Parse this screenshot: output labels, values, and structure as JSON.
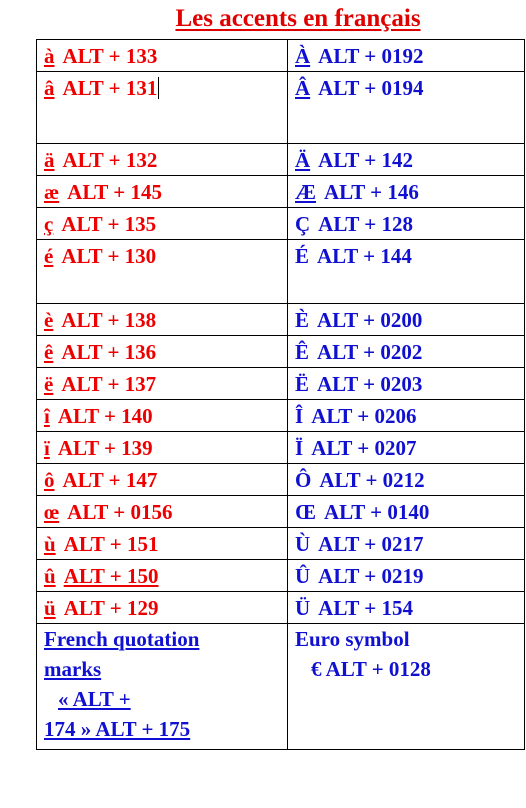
{
  "title": "Les accents en français",
  "colors": {
    "title_red": "#e00000",
    "lowercase_red": "#ee0000",
    "uppercase_blue": "#1010d0",
    "border_black": "#000000",
    "background": "#ffffff"
  },
  "table": {
    "rows": [
      {
        "left": {
          "letter": "à",
          "code": "ALT + 133",
          "letter_underlined": true,
          "code_underlined": false,
          "caret": false
        },
        "right": {
          "letter": "À",
          "code": "ALT + 0192",
          "letter_underlined": true,
          "code_underlined": false
        }
      },
      {
        "left": {
          "letter": "â",
          "code": "ALT + 131",
          "letter_underlined": true,
          "code_underlined": false,
          "caret": true
        },
        "right": {
          "letter": "Â",
          "code": "ALT + 0194",
          "letter_underlined": true,
          "code_underlined": false
        }
      },
      {
        "left": {
          "letter": "ä",
          "code": "ALT + 132",
          "letter_underlined": true,
          "code_underlined": false,
          "caret": false
        },
        "right": {
          "letter": "Ä",
          "code": "ALT + 142",
          "letter_underlined": true,
          "code_underlined": false
        }
      },
      {
        "left": {
          "letter": "æ",
          "code": "ALT + 145",
          "letter_underlined": true,
          "code_underlined": false,
          "caret": false
        },
        "right": {
          "letter": "Æ",
          "code": "ALT + 146",
          "letter_underlined": true,
          "code_underlined": false
        }
      },
      {
        "left": {
          "letter": "ç",
          "code": "ALT + 135",
          "letter_underlined": true,
          "code_underlined": false,
          "caret": false
        },
        "right": {
          "letter": "Ç",
          "code": "ALT + 128",
          "letter_underlined": false,
          "code_underlined": false
        }
      },
      {
        "left": {
          "letter": "é",
          "code": "ALT + 130",
          "letter_underlined": true,
          "code_underlined": false,
          "caret": false
        },
        "right": {
          "letter": "É",
          "code": "ALT + 144",
          "letter_underlined": false,
          "code_underlined": false
        }
      },
      {
        "left": {
          "letter": "è",
          "code": "ALT + 138",
          "letter_underlined": true,
          "code_underlined": false,
          "caret": false
        },
        "right": {
          "letter": "È",
          "code": "ALT + 0200",
          "letter_underlined": false,
          "code_underlined": false
        }
      },
      {
        "left": {
          "letter": "ê",
          "code": "ALT + 136",
          "letter_underlined": true,
          "code_underlined": false,
          "caret": false
        },
        "right": {
          "letter": "Ê",
          "code": "ALT + 0202",
          "letter_underlined": false,
          "code_underlined": false
        }
      },
      {
        "left": {
          "letter": "ë",
          "code": "ALT + 137",
          "letter_underlined": true,
          "code_underlined": false,
          "caret": false
        },
        "right": {
          "letter": "Ë",
          "code": "ALT + 0203",
          "letter_underlined": false,
          "code_underlined": false
        }
      },
      {
        "left": {
          "letter": "î",
          "code": "ALT + 140",
          "letter_underlined": true,
          "code_underlined": false,
          "caret": false
        },
        "right": {
          "letter": "Î",
          "code": "ALT + 0206",
          "letter_underlined": false,
          "code_underlined": false
        }
      },
      {
        "left": {
          "letter": "ï",
          "code": "ALT + 139",
          "letter_underlined": true,
          "code_underlined": false,
          "caret": false
        },
        "right": {
          "letter": "Ï",
          "code": "ALT + 0207",
          "letter_underlined": false,
          "code_underlined": false
        }
      },
      {
        "left": {
          "letter": "ô",
          "code": "ALT + 147",
          "letter_underlined": true,
          "code_underlined": false,
          "caret": false
        },
        "right": {
          "letter": "Ô",
          "code": "ALT + 0212",
          "letter_underlined": false,
          "code_underlined": false
        }
      },
      {
        "left": {
          "letter": "œ",
          "code": "ALT + 0156",
          "letter_underlined": true,
          "code_underlined": false,
          "caret": false
        },
        "right": {
          "letter": "Œ",
          "code": "ALT + 0140",
          "letter_underlined": false,
          "code_underlined": false
        }
      },
      {
        "left": {
          "letter": "ù",
          "code": "ALT + 151",
          "letter_underlined": true,
          "code_underlined": false,
          "caret": false
        },
        "right": {
          "letter": "Ù",
          "code": "ALT + 0217",
          "letter_underlined": false,
          "code_underlined": false
        }
      },
      {
        "left": {
          "letter": "û",
          "code": "ALT + 150",
          "letter_underlined": true,
          "code_underlined": true,
          "caret": false
        },
        "right": {
          "letter": "Û",
          "code": "ALT + 0219",
          "letter_underlined": false,
          "code_underlined": false
        }
      },
      {
        "left": {
          "letter": "ü",
          "code": "ALT + 129",
          "letter_underlined": true,
          "code_underlined": false,
          "caret": false
        },
        "right": {
          "letter": "Ü",
          "code": "ALT + 154",
          "letter_underlined": false,
          "code_underlined": false
        }
      }
    ],
    "footer": {
      "quotation": {
        "heading_line1": "French quotation",
        "heading_line2": "marks",
        "body_line1": "« ALT +",
        "body_line2": "174   » ALT + 175"
      },
      "euro": {
        "heading": "Euro symbol",
        "body": "€  ALT + 0128"
      }
    }
  }
}
